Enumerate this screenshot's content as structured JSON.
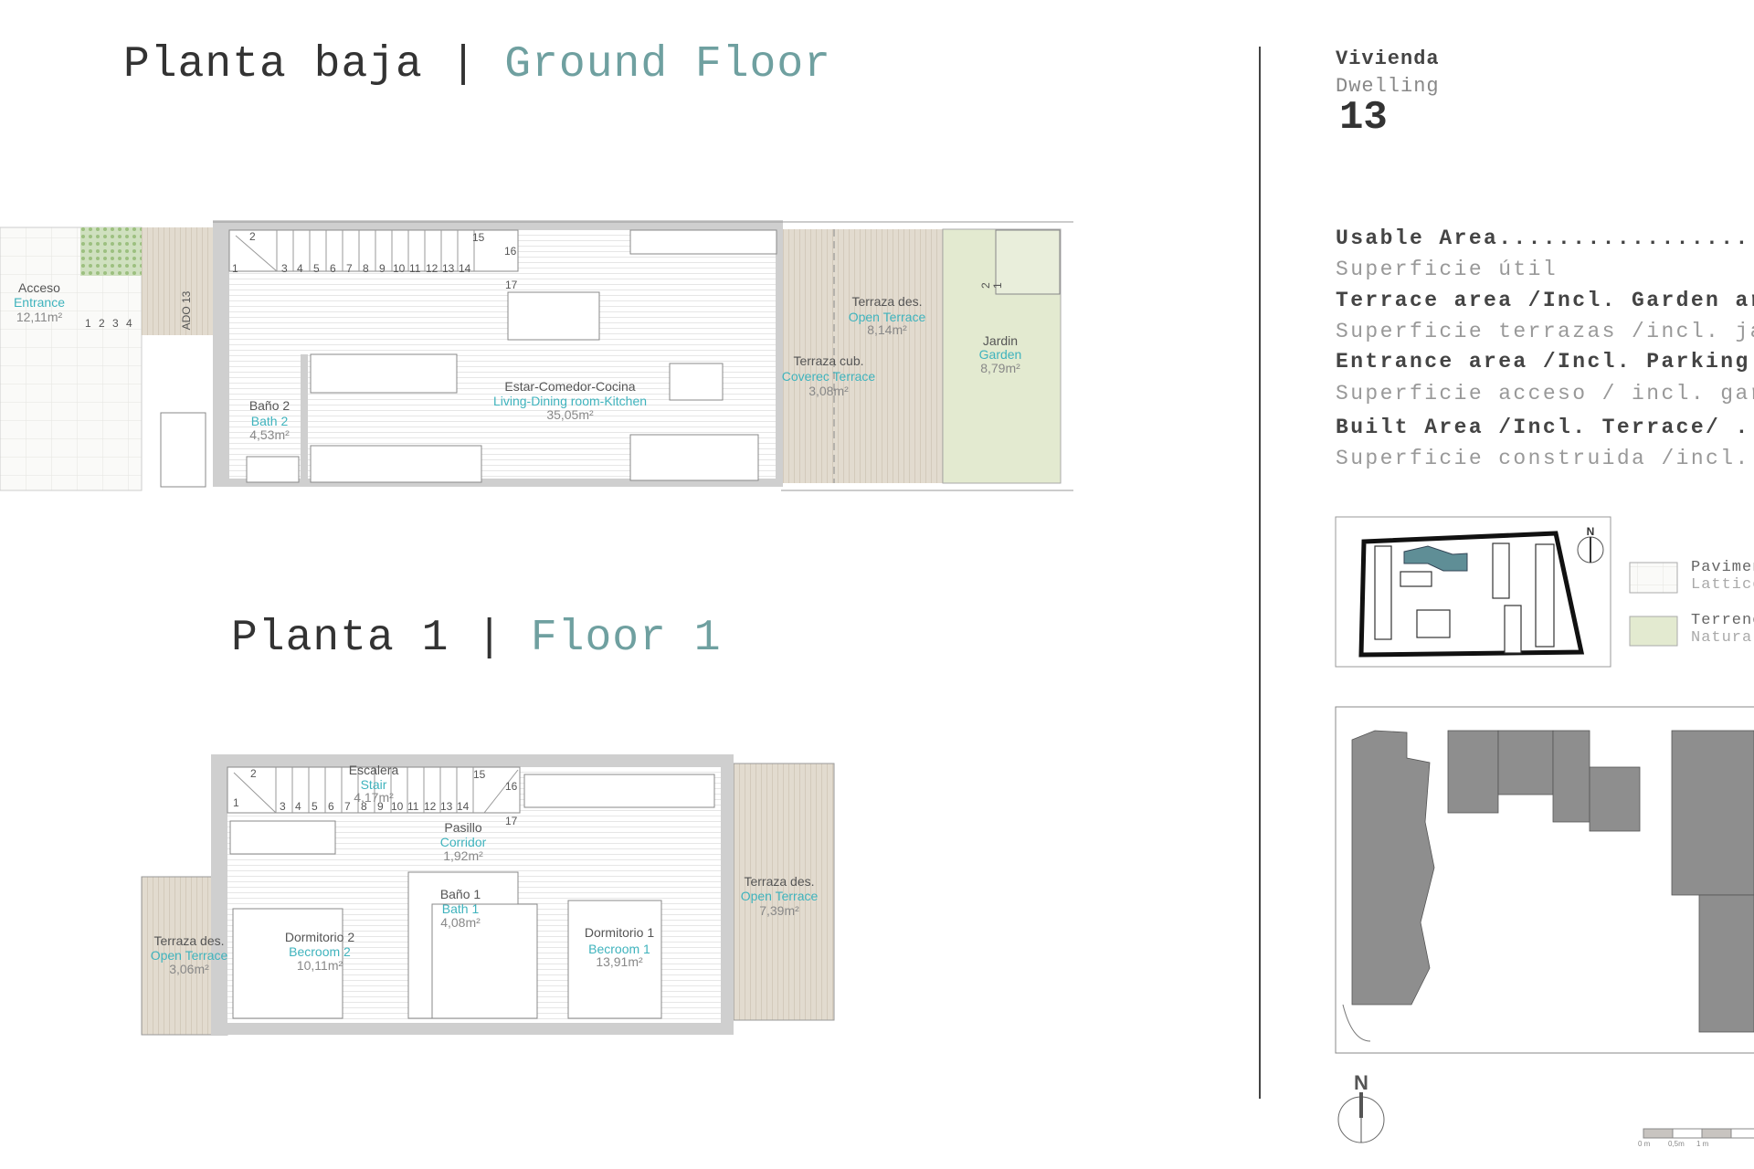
{
  "ground_floor": {
    "title_es": "Planta baja",
    "separator": "|",
    "title_en": "Ground Floor",
    "entrance_label": "ADO 13",
    "stair_numbers": [
      "1",
      "2",
      "3",
      "4",
      "5",
      "6",
      "7",
      "8",
      "9",
      "10",
      "11",
      "12",
      "13",
      "14",
      "15",
      "16",
      "17"
    ],
    "entrance_steps": [
      "1",
      "2",
      "3",
      "4"
    ],
    "garden_steps": [
      "1",
      "2"
    ],
    "rooms": [
      {
        "es": "Acceso",
        "en": "Entrance",
        "area": "12,11m²"
      },
      {
        "es": "Baño 2",
        "en": "Bath 2",
        "area": "4,53m²"
      },
      {
        "es": "Estar-Comedor-Cocina",
        "en": "Living-Dining room-Kitchen",
        "area": "35,05m²"
      },
      {
        "es": "Terraza des.",
        "en": "Open Terrace",
        "area": "8,14m²"
      },
      {
        "es": "Terraza cub.",
        "en": "Coverec Terrace",
        "area": "3,08m²"
      },
      {
        "es": "Jardin",
        "en": "Garden",
        "area": "8,79m²"
      }
    ]
  },
  "floor_1": {
    "title_es": "Planta 1",
    "separator": "|",
    "title_en": "Floor 1",
    "stair_numbers": [
      "1",
      "2",
      "3",
      "4",
      "5",
      "6",
      "7",
      "8",
      "9",
      "10",
      "11",
      "12",
      "13",
      "14",
      "15",
      "16",
      "17"
    ],
    "rooms": [
      {
        "es": "Escalera",
        "en": "Stair",
        "area": "4,17m²"
      },
      {
        "es": "Pasillo",
        "en": "Corridor",
        "area": "1,92m²"
      },
      {
        "es": "Baño 1",
        "en": "Bath 1",
        "area": "4,08m²"
      },
      {
        "es": "Dormitorio 2",
        "en": "Becroom 2",
        "area": "10,11m²"
      },
      {
        "es": "Dormitorio 1",
        "en": "Becroom 1",
        "area": "13,91m²"
      },
      {
        "es": "Terraza des.",
        "en": "Open Terrace",
        "area": "3,06m²"
      },
      {
        "es": "Terraza des.",
        "en": "Open Terrace",
        "area": "7,39m²"
      }
    ]
  },
  "dwelling": {
    "label_es": "Vivienda",
    "label_en": "Dwelling",
    "number": "13"
  },
  "areas": [
    {
      "en": "Usable Area....................",
      "es": "Superficie útil"
    },
    {
      "en": "Terrace area /Incl. Garden ar",
      "es": "Superficie terrazas /incl. ja"
    },
    {
      "en": "Entrance area /Incl. Parking ",
      "es": "Superficie acceso / incl. gar"
    },
    {
      "en": "Built Area /Incl. Terrace/ ..",
      "es": "Superficie construida /incl. "
    }
  ],
  "legend": [
    {
      "es": "Pavimen",
      "en": "Lattice",
      "color": "#e4e2da"
    },
    {
      "es": "Terreno",
      "en": "Natural",
      "color": "#e3ead0"
    }
  ],
  "site_plan": {
    "north": "N",
    "highlight_color": "#5f8e96"
  },
  "north_arrow": {
    "label": "N"
  },
  "scale_bar": {
    "ticks": [
      "0 m",
      "0,5m",
      "1 m"
    ]
  },
  "colors": {
    "accent": "#3fb3bd",
    "title_accent": "#6fa0a0",
    "terrace": "#e2dbcf",
    "garden": "#e3ead0",
    "wall": "#cfcfcf"
  }
}
